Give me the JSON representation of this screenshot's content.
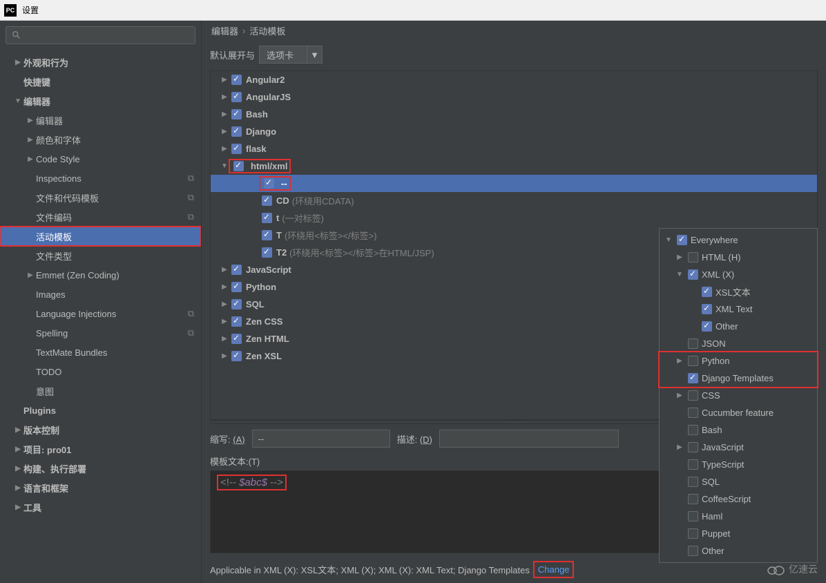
{
  "window": {
    "title": "设置",
    "app_icon_text": "PC"
  },
  "breadcrumb": {
    "p1": "编辑器",
    "p2": "活动模板"
  },
  "expand": {
    "label": "默认展开与",
    "combo_value": "选项卡"
  },
  "sidebar": [
    {
      "label": "外观和行为",
      "lvl": 1,
      "arrow": "▶",
      "bold": true
    },
    {
      "label": "快捷键",
      "lvl": 1,
      "arrow": "",
      "bold": true
    },
    {
      "label": "编辑器",
      "lvl": 1,
      "arrow": "▼",
      "bold": true
    },
    {
      "label": "编辑器",
      "lvl": 2,
      "arrow": "▶"
    },
    {
      "label": "颜色和字体",
      "lvl": 2,
      "arrow": "▶"
    },
    {
      "label": "Code Style",
      "lvl": 2,
      "arrow": "▶"
    },
    {
      "label": "Inspections",
      "lvl": 2,
      "arrow": "",
      "copy": true
    },
    {
      "label": "文件和代码模板",
      "lvl": 2,
      "arrow": "",
      "copy": true
    },
    {
      "label": "文件编码",
      "lvl": 2,
      "arrow": "",
      "copy": true
    },
    {
      "label": "活动模板",
      "lvl": 2,
      "arrow": "",
      "selected": true,
      "red": true
    },
    {
      "label": "文件类型",
      "lvl": 2,
      "arrow": ""
    },
    {
      "label": "Emmet (Zen Coding)",
      "lvl": 2,
      "arrow": "▶"
    },
    {
      "label": "Images",
      "lvl": 2,
      "arrow": ""
    },
    {
      "label": "Language Injections",
      "lvl": 2,
      "arrow": "",
      "copy": true
    },
    {
      "label": "Spelling",
      "lvl": 2,
      "arrow": "",
      "copy": true
    },
    {
      "label": "TextMate Bundles",
      "lvl": 2,
      "arrow": ""
    },
    {
      "label": "TODO",
      "lvl": 2,
      "arrow": ""
    },
    {
      "label": "意图",
      "lvl": 2,
      "arrow": ""
    },
    {
      "label": "Plugins",
      "lvl": 1,
      "arrow": "",
      "bold": true
    },
    {
      "label": "版本控制",
      "lvl": 1,
      "arrow": "▶",
      "bold": true
    },
    {
      "label": "项目: pro01",
      "lvl": 1,
      "arrow": "▶",
      "bold": true
    },
    {
      "label": "构建、执行部署",
      "lvl": 1,
      "arrow": "▶",
      "bold": true
    },
    {
      "label": "语言和框架",
      "lvl": 1,
      "arrow": "▶",
      "bold": true
    },
    {
      "label": "工具",
      "lvl": 1,
      "arrow": "▶",
      "bold": true
    }
  ],
  "templates": [
    {
      "name": "Angular2",
      "lvl": 1,
      "arrow": "▶",
      "chk": true
    },
    {
      "name": "AngularJS",
      "lvl": 1,
      "arrow": "▶",
      "chk": true
    },
    {
      "name": "Bash",
      "lvl": 1,
      "arrow": "▶",
      "chk": true
    },
    {
      "name": "Django",
      "lvl": 1,
      "arrow": "▶",
      "chk": true
    },
    {
      "name": "flask",
      "lvl": 1,
      "arrow": "▶",
      "chk": true
    },
    {
      "name": "html/xml",
      "lvl": 1,
      "arrow": "▼",
      "chk": true,
      "red": true
    },
    {
      "name": "--",
      "lvl": 2,
      "arrow": "",
      "chk": true,
      "selected": true,
      "red": true
    },
    {
      "name": "CD",
      "hint": "(环绕用CDATA)",
      "lvl": 2,
      "arrow": "",
      "chk": true
    },
    {
      "name": "t",
      "hint": "(一对标签)",
      "lvl": 2,
      "arrow": "",
      "chk": true
    },
    {
      "name": "T",
      "hint": "(环绕用<标签></标签>)",
      "lvl": 2,
      "arrow": "",
      "chk": true
    },
    {
      "name": "T2",
      "hint": "(环绕用<标签></标签>在HTML/JSP)",
      "lvl": 2,
      "arrow": "",
      "chk": true
    },
    {
      "name": "JavaScript",
      "lvl": 1,
      "arrow": "▶",
      "chk": true
    },
    {
      "name": "Python",
      "lvl": 1,
      "arrow": "▶",
      "chk": true
    },
    {
      "name": "SQL",
      "lvl": 1,
      "arrow": "▶",
      "chk": true
    },
    {
      "name": "Zen CSS",
      "lvl": 1,
      "arrow": "▶",
      "chk": true
    },
    {
      "name": "Zen HTML",
      "lvl": 1,
      "arrow": "▶",
      "chk": true
    },
    {
      "name": "Zen XSL",
      "lvl": 1,
      "arrow": "▶",
      "chk": true
    }
  ],
  "form": {
    "abbr_label": "缩写:",
    "abbr_key": "(A)",
    "abbr_value": "--",
    "desc_label": "描述:",
    "desc_key": "(D)",
    "desc_value": "",
    "tmpl_text_label": "模板文本:",
    "tmpl_text_key": "(T)",
    "code_prefix": "<!-- ",
    "code_var": "$abc$",
    "code_suffix": " -->"
  },
  "applicable": {
    "text": "Applicable in XML (X): XSL文本; XML (X); XML (X): XML Text; Django Templates",
    "change": "Change"
  },
  "context": [
    {
      "label": "Everywhere",
      "lvl": 1,
      "arrow": "▼",
      "chk": true
    },
    {
      "label": "HTML (H)",
      "lvl": 2,
      "arrow": "▶",
      "chk": false
    },
    {
      "label": "XML (X)",
      "lvl": 2,
      "arrow": "▼",
      "chk": true
    },
    {
      "label": "XSL文本",
      "lvl": 3,
      "arrow": "",
      "chk": true
    },
    {
      "label": "XML Text",
      "lvl": 3,
      "arrow": "",
      "chk": true
    },
    {
      "label": "Other",
      "lvl": 3,
      "arrow": "",
      "chk": true
    },
    {
      "label": "JSON",
      "lvl": 2,
      "arrow": "",
      "chk": false
    },
    {
      "label": "Python",
      "lvl": 2,
      "arrow": "▶",
      "chk": false,
      "red": true
    },
    {
      "label": "Django Templates",
      "lvl": 2,
      "arrow": "",
      "chk": true,
      "red": true
    },
    {
      "label": "CSS",
      "lvl": 2,
      "arrow": "▶",
      "chk": false
    },
    {
      "label": "Cucumber feature",
      "lvl": 2,
      "arrow": "",
      "chk": false
    },
    {
      "label": "Bash",
      "lvl": 2,
      "arrow": "",
      "chk": false
    },
    {
      "label": "JavaScript",
      "lvl": 2,
      "arrow": "▶",
      "chk": false
    },
    {
      "label": "TypeScript",
      "lvl": 2,
      "arrow": "",
      "chk": false
    },
    {
      "label": "SQL",
      "lvl": 2,
      "arrow": "",
      "chk": false
    },
    {
      "label": "CoffeeScript",
      "lvl": 2,
      "arrow": "",
      "chk": false
    },
    {
      "label": "Haml",
      "lvl": 2,
      "arrow": "",
      "chk": false
    },
    {
      "label": "Puppet",
      "lvl": 2,
      "arrow": "",
      "chk": false
    },
    {
      "label": "Other",
      "lvl": 2,
      "arrow": "",
      "chk": false
    }
  ],
  "watermark": "亿速云"
}
